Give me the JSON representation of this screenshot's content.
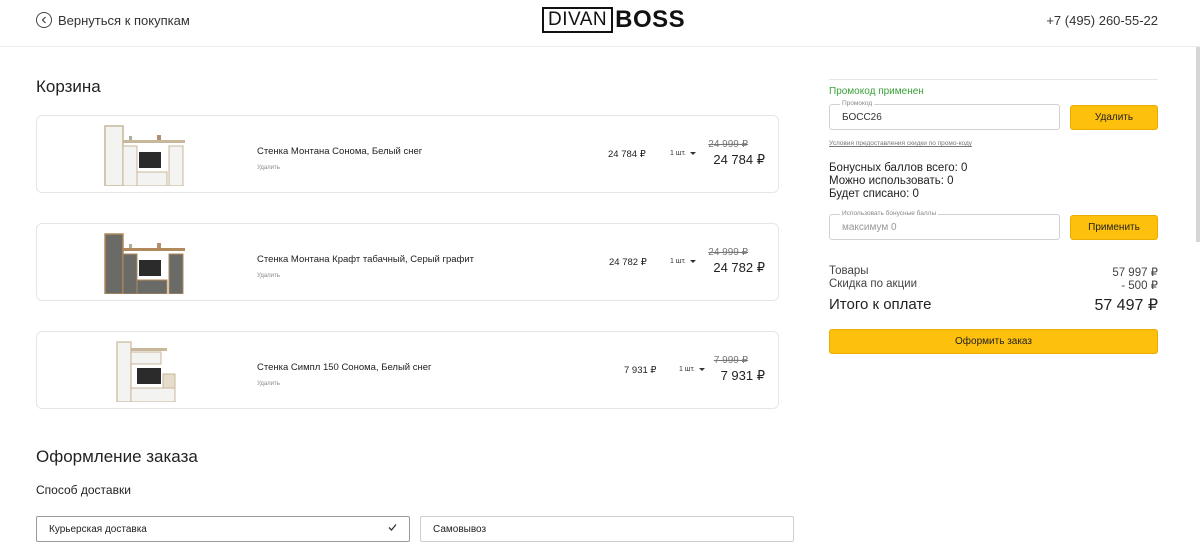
{
  "header": {
    "back_label": "Вернуться к покупкам",
    "logo_box": "DIVAN",
    "logo_text": "BOSS",
    "phone": "+7 (495) 260-55-22"
  },
  "cart": {
    "title": "Корзина",
    "remove_label": "Удалить",
    "items": [
      {
        "name": "Стенка Монтана Сонома, Белый снег",
        "price": "24 784 ₽",
        "qty": "1 шт.",
        "old_price": "24 999 ₽",
        "new_price": "24 784 ₽"
      },
      {
        "name": "Стенка Монтана Крафт табачный, Серый графит",
        "price": "24 782 ₽",
        "qty": "1 шт.",
        "old_price": "24 999 ₽",
        "new_price": "24 782 ₽"
      },
      {
        "name": "Стенка Симпл 150 Сонома, Белый снег",
        "price": "7 931 ₽",
        "qty": "1 шт.",
        "old_price": "7 999 ₽",
        "new_price": "7 931 ₽"
      }
    ]
  },
  "order": {
    "title": "Оформление заказа",
    "delivery_title": "Способ доставки",
    "delivery_options": [
      "Курьерская доставка",
      "Самовывоз"
    ],
    "selected_delivery": "Курьерская доставка"
  },
  "sidebar": {
    "promo_applied": "Промокод применен",
    "promo_label": "Промокод",
    "promo_value": "БОСС26",
    "remove_button": "Удалить",
    "promo_terms": "Условия предоставления скидки по промо-коду",
    "bonus_total": "Бонусных баллов всего: 0",
    "bonus_available": "Можно использовать: 0",
    "bonus_writeoff": "Будет списано: 0",
    "bonus_label": "Использовать бонусные баллы",
    "bonus_placeholder": "максимум 0",
    "apply_button": "Применить",
    "goods_label": "Товары",
    "goods_value": "57 997 ₽",
    "discount_label": "Скидка по акции",
    "discount_value": "- 500 ₽",
    "total_label": "Итого к оплате",
    "total_value": "57 497 ₽",
    "checkout_button": "Оформить заказ"
  },
  "colors": {
    "accent": "#fdc00c",
    "success": "#3aa03a"
  }
}
